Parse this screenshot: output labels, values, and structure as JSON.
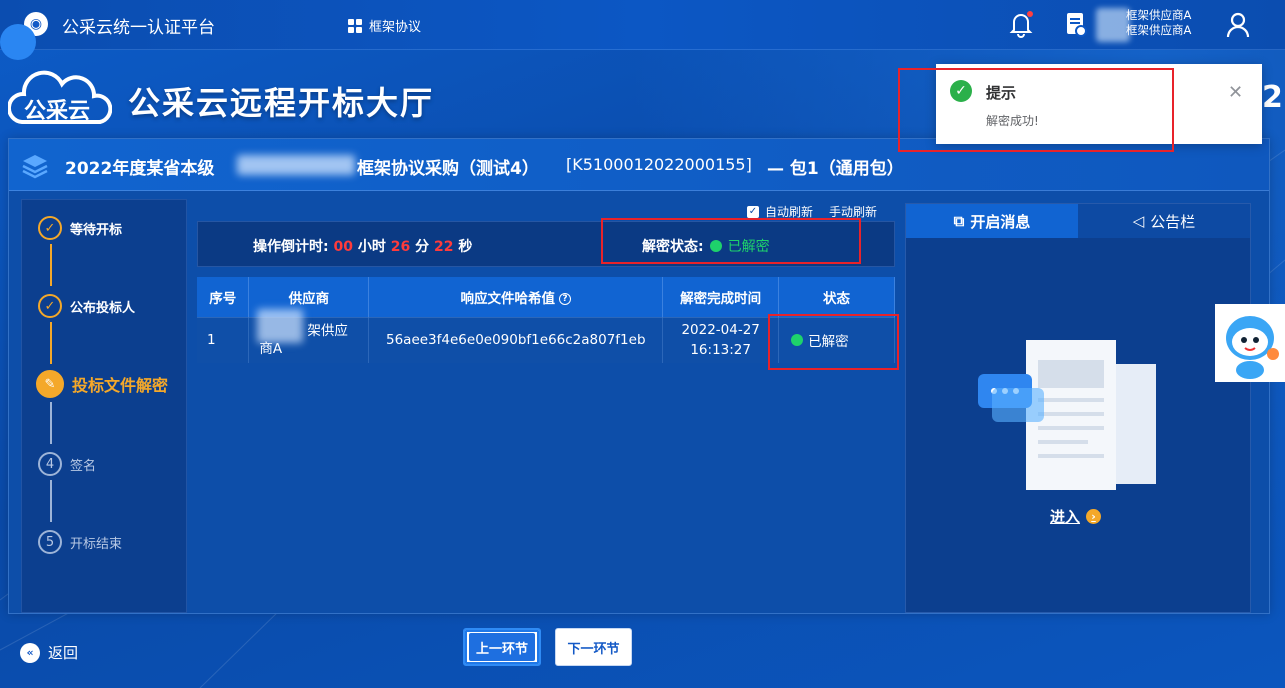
{
  "topbar": {
    "platform_title": "公采云统一认证平台",
    "nav_tab_label": "框架协议",
    "user_line1": "框架供应商A",
    "user_line2": "框架供应商A"
  },
  "header": {
    "hall_title": "公采云远程开标大厅",
    "logo_text": "公采云",
    "right_digit": "2"
  },
  "project": {
    "title_prefix": "2022年度某省本级",
    "title_suffix": "框架协议采购（测试4）",
    "code": "[K5100012022000155]",
    "package": "— 包1（通用包）"
  },
  "steps": [
    {
      "num": "1",
      "label": "等待开标",
      "state": "done"
    },
    {
      "num": "2",
      "label": "公布投标人",
      "state": "done"
    },
    {
      "num": "3",
      "label": "投标文件解密",
      "state": "active"
    },
    {
      "num": "4",
      "label": "签名",
      "state": "todo"
    },
    {
      "num": "5",
      "label": "开标结束",
      "state": "todo"
    }
  ],
  "refresh": {
    "auto_label": "自动刷新",
    "manual_label": "手动刷新"
  },
  "countdown": {
    "label": "操作倒计时:",
    "hours": "00",
    "hours_unit": "小时",
    "minutes": "26",
    "minutes_unit": "分",
    "seconds": "22",
    "seconds_unit": "秒"
  },
  "decrypt": {
    "label": "解密状态:",
    "value": "已解密"
  },
  "table": {
    "headers": [
      "序号",
      "供应商",
      "响应文件哈希值",
      "解密完成时间",
      "状态"
    ],
    "rows": [
      {
        "index": "1",
        "supplier_line1": "架供应",
        "supplier_line2": "商A",
        "hash": "56aee3f4e6e0e090bf1e66c2a807f1eb",
        "time_date": "2022-04-27",
        "time_clock": "16:13:27",
        "status": "已解密"
      }
    ]
  },
  "right_panel": {
    "tab_active": "开启消息",
    "tab_inactive": "公告栏",
    "enter_label": "进入"
  },
  "bottom": {
    "back_label": "返回",
    "prev_label": "上一环节",
    "next_label": "下一环节"
  },
  "toast": {
    "title": "提示",
    "message": "解密成功!"
  },
  "colors": {
    "accent_orange": "#f4a82a",
    "success_green": "#1ed26b",
    "countdown_red": "#ff3b3b",
    "highlight_red": "#e8232a"
  }
}
